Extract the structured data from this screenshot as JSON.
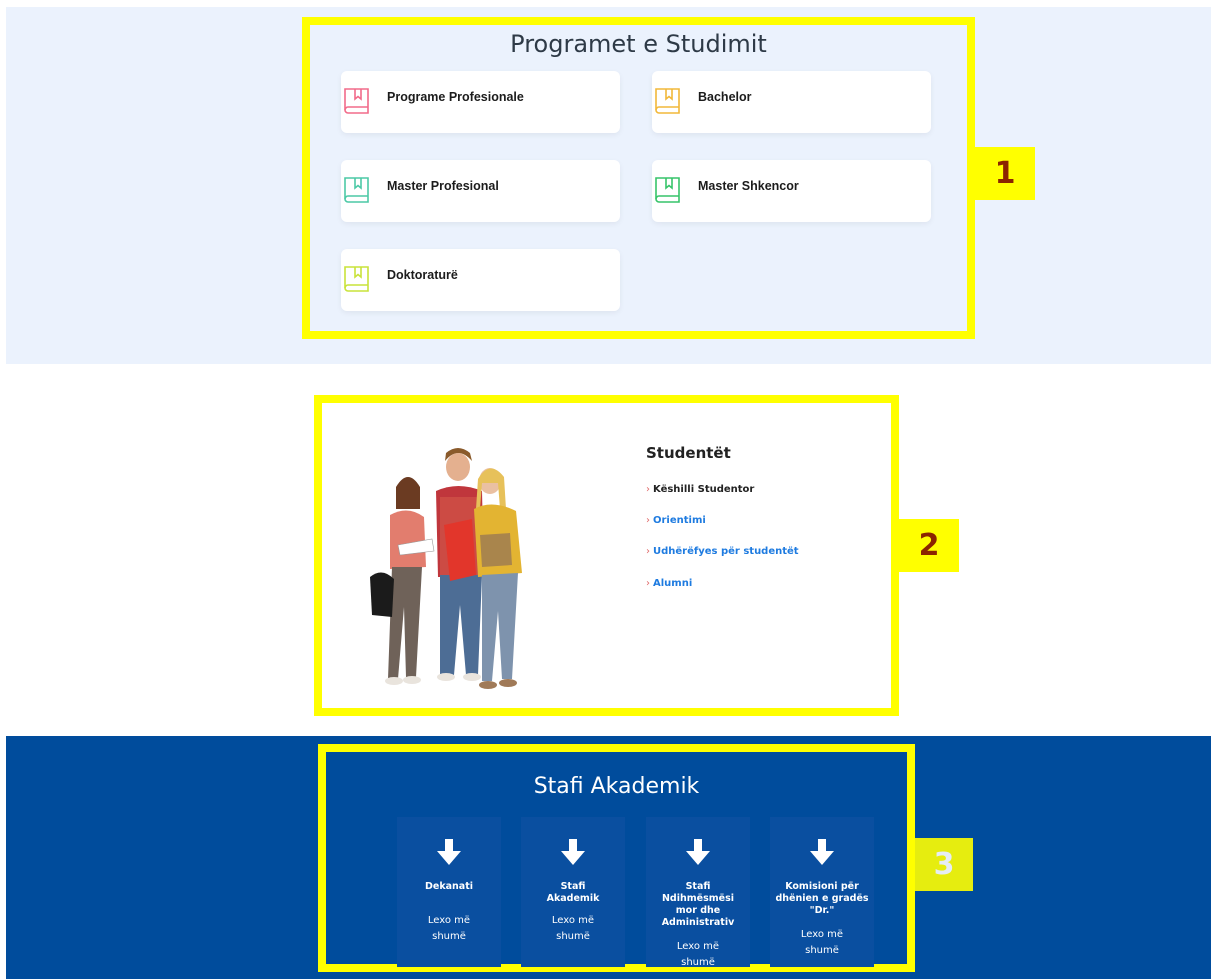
{
  "programs": {
    "title": "Programet e Studimit",
    "items": [
      {
        "label": "Programe Profesionale",
        "color": "#f26b8a"
      },
      {
        "label": "Bachelor",
        "color": "#f2b83a"
      },
      {
        "label": "Master Profesional",
        "color": "#4cc9a6"
      },
      {
        "label": "Master Shkencor",
        "color": "#37c46a"
      },
      {
        "label": "Doktoraturë",
        "color": "#c9e33a"
      }
    ]
  },
  "students": {
    "title": "Studentët",
    "links": [
      {
        "label": "Këshilli Studentor",
        "color": "#222222"
      },
      {
        "label": "Orientimi",
        "color": "#1e7be0"
      },
      {
        "label": "Udhërëfyes për studentët",
        "color": "#1e7be0"
      },
      {
        "label": "Alumni",
        "color": "#1e7be0"
      }
    ]
  },
  "staff": {
    "title": "Stafi Akademik",
    "read_more": "Lexo më shumë",
    "cards": [
      {
        "name": "Dekanati"
      },
      {
        "name": "Stafi Akademik"
      },
      {
        "name": "Stafi Ndihmësmësi mor dhe Administrativ"
      },
      {
        "name": "Komisioni për dhënien e gradës \"Dr.\""
      }
    ]
  },
  "annotations": {
    "badge1": "1",
    "badge2": "2",
    "badge3": "3"
  },
  "colors": {
    "highlight": "#ffff00",
    "badge_text": "#8b2500",
    "section1_bg": "#ebf2fd",
    "section3_bg": "#004c9c"
  }
}
